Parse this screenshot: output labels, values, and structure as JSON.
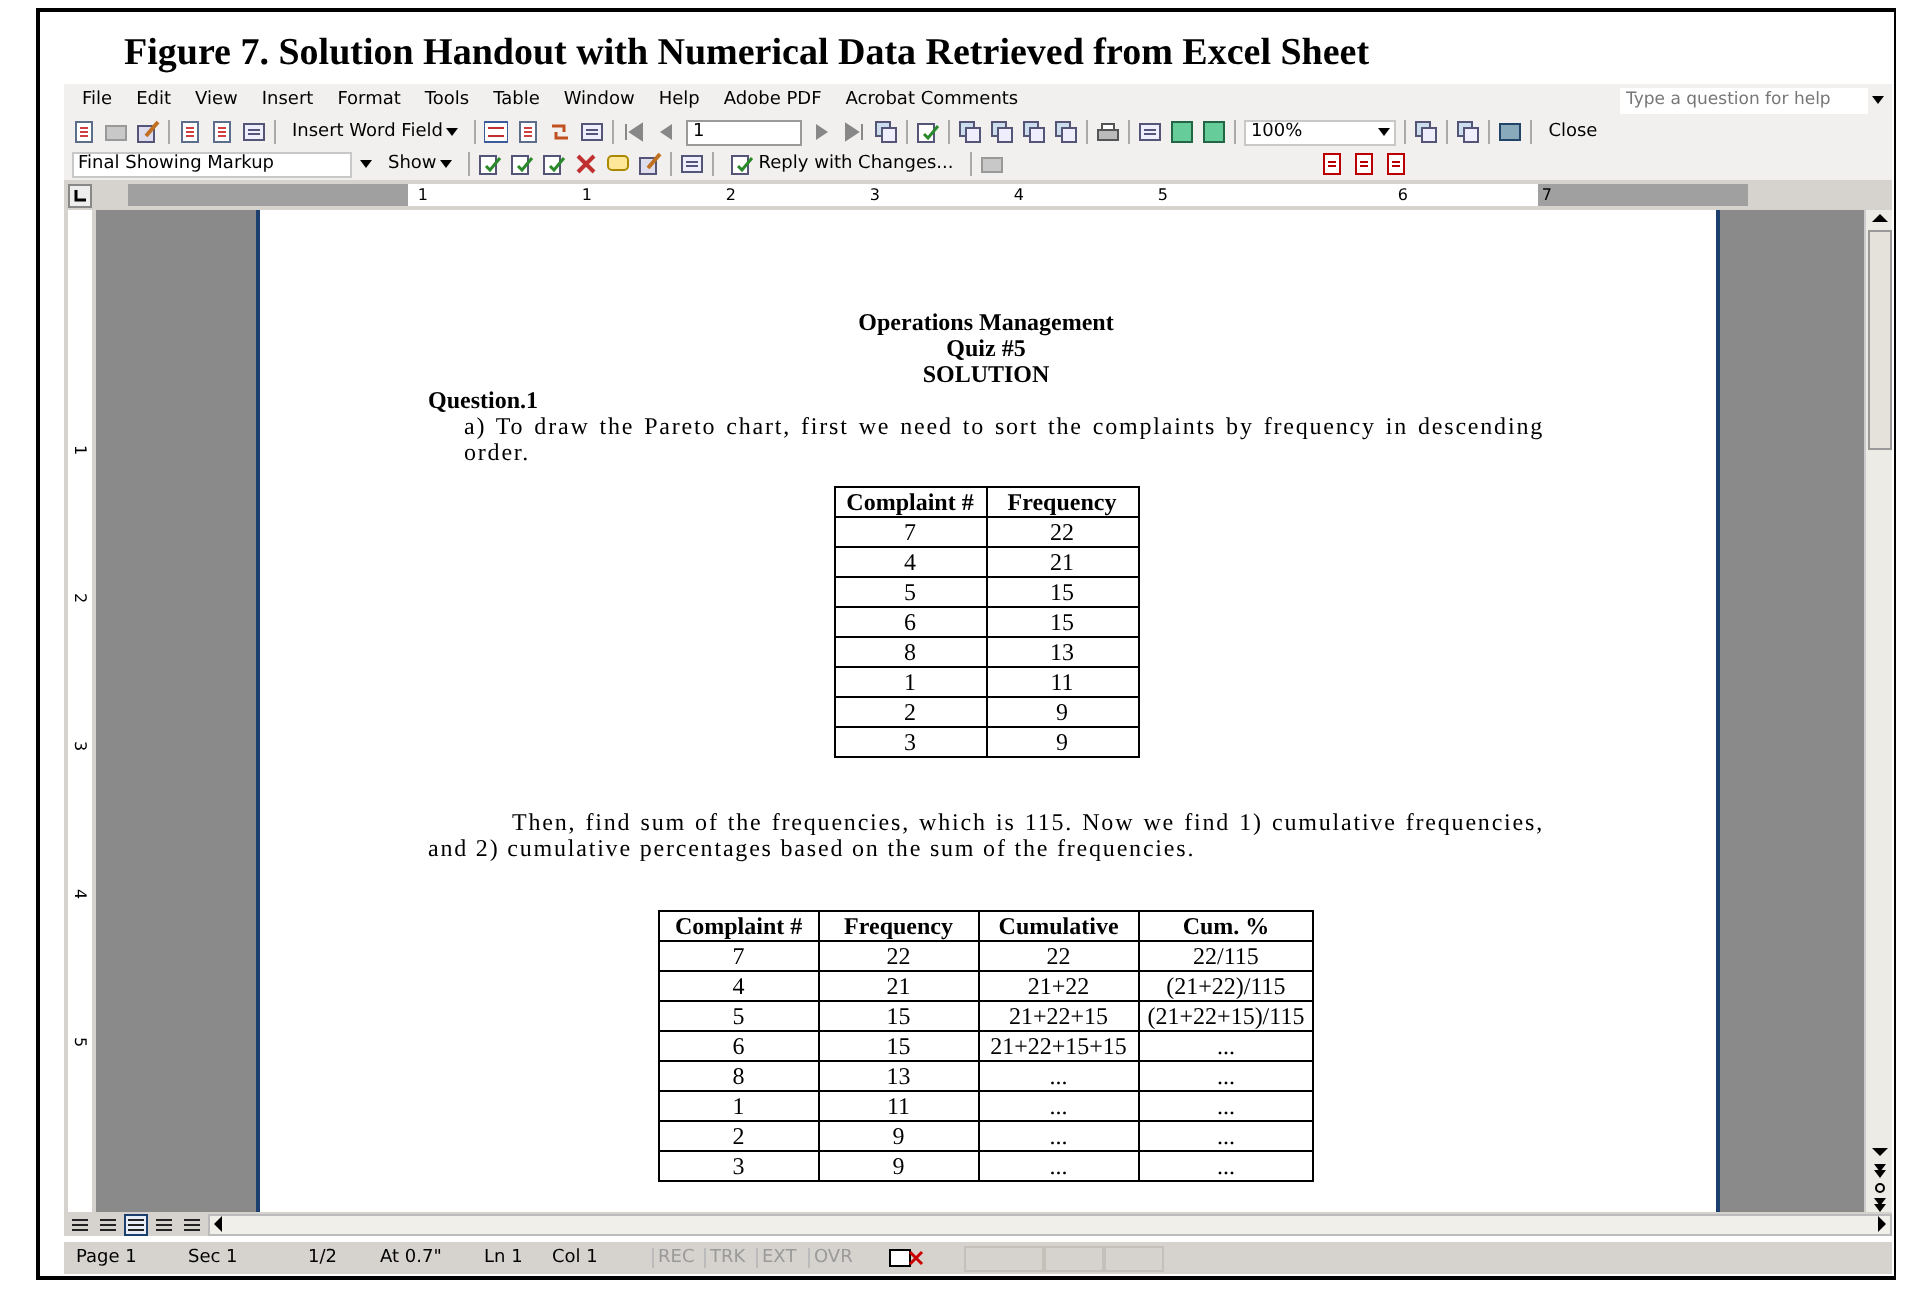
{
  "caption": "Figure 7. Solution Handout with Numerical Data Retrieved from Excel Sheet",
  "menu": [
    "File",
    "Edit",
    "View",
    "Insert",
    "Format",
    "Tools",
    "Table",
    "Window",
    "Help",
    "Adobe PDF",
    "Acrobat Comments"
  ],
  "help_field": {
    "placeholder": "Type a question for help"
  },
  "toolbar": {
    "insert_word_field": "Insert Word Field",
    "record_field": "1",
    "zoom": "100%",
    "close": "Close"
  },
  "review_toolbar": {
    "display": "Final Showing Markup",
    "show": "Show",
    "reply": "Reply with Changes..."
  },
  "ruler": {
    "horizontal": [
      "1",
      "1",
      "2",
      "3",
      "4",
      "5",
      "6",
      "7"
    ],
    "vertical": [
      "1",
      "2",
      "3",
      "4",
      "5"
    ]
  },
  "document": {
    "title_lines": [
      "Operations Management",
      "Quiz #5",
      "SOLUTION"
    ],
    "heading": "Question.1",
    "paragraph_1": "a) To draw the Pareto chart, first we need to sort the complaints by frequency in descending order.",
    "table_1": {
      "columns": [
        "Complaint #",
        "Frequency"
      ],
      "rows": [
        [
          "7",
          "22"
        ],
        [
          "4",
          "21"
        ],
        [
          "5",
          "15"
        ],
        [
          "6",
          "15"
        ],
        [
          "8",
          "13"
        ],
        [
          "1",
          "11"
        ],
        [
          "2",
          "9"
        ],
        [
          "3",
          "9"
        ]
      ]
    },
    "paragraph_2": "Then, find sum of the frequencies, which is 115. Now we find 1) cumulative frequencies, and 2) cumulative percentages based on the sum of the frequencies.",
    "table_2": {
      "columns": [
        "Complaint #",
        "Frequency",
        "Cumulative",
        "Cum. %"
      ],
      "rows": [
        [
          "7",
          "22",
          "22",
          "22/115"
        ],
        [
          "4",
          "21",
          "21+22",
          "(21+22)/115"
        ],
        [
          "5",
          "15",
          "21+22+15",
          "(21+22+15)/115"
        ],
        [
          "6",
          "15",
          "21+22+15+15",
          "..."
        ],
        [
          "8",
          "13",
          "...",
          "..."
        ],
        [
          "1",
          "11",
          "...",
          "..."
        ],
        [
          "2",
          "9",
          "...",
          "..."
        ],
        [
          "3",
          "9",
          "...",
          "..."
        ]
      ]
    }
  },
  "view_buttons": [
    {
      "selected": false
    },
    {
      "selected": false
    },
    {
      "selected": true
    },
    {
      "selected": false
    },
    {
      "selected": false
    }
  ],
  "status_bar": {
    "fields": [
      "Page 1",
      "Sec 1",
      "1/2",
      "At 0.7\"",
      "Ln 1",
      "Col 1"
    ],
    "indicators": [
      {
        "label": "REC",
        "on": false
      },
      {
        "label": "TRK",
        "on": false
      },
      {
        "label": "EXT",
        "on": false
      },
      {
        "label": "OVR",
        "on": false
      }
    ]
  }
}
